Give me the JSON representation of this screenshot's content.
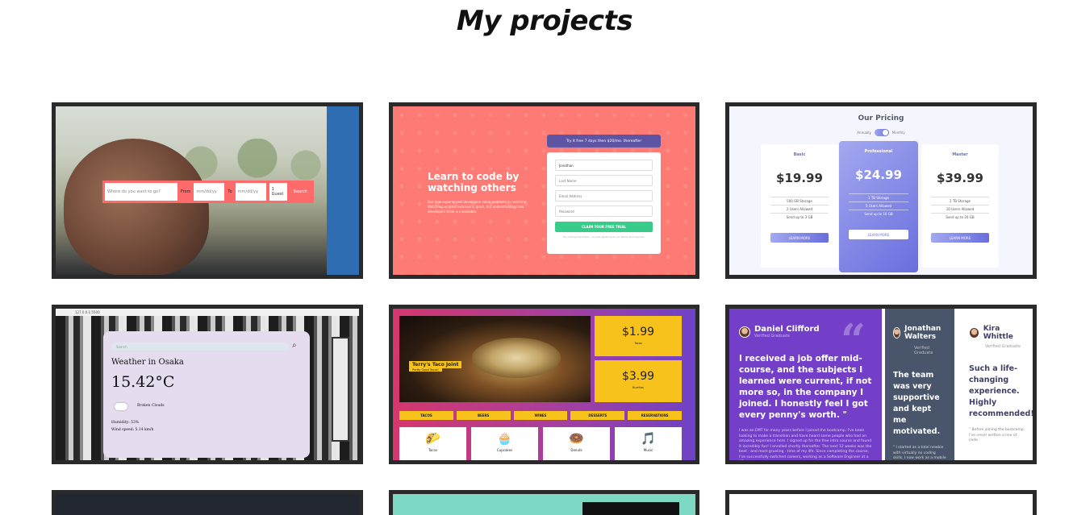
{
  "page": {
    "title": "My projects"
  },
  "projects": [
    {
      "name": "travel-search",
      "search_placeholder": "Where do you want to go?",
      "from_label": "From",
      "date_placeholder": "mm/dd/yy",
      "to_label": "To",
      "guests": "1 Guest",
      "search_button": "Search"
    },
    {
      "name": "learn-to-code",
      "heading": "Learn to code by watching others",
      "subtext": "See how experienced developers solve problems in real-time. Watching scripted tutorials is great, but understanding how developers think is invaluable.",
      "trial_banner": "Try it free 7 days then $20/mo. thereafter",
      "first_name_value": "Jonathan",
      "last_name_placeholder": "Last Name",
      "email_placeholder": "Email Address",
      "password_placeholder": "Password",
      "claim_button": "CLAIM YOUR FREE TRIAL",
      "terms": "By clicking the button, you are agreeing to our Terms and Services"
    },
    {
      "name": "pricing",
      "title": "Our Pricing",
      "toggle_left": "Annually",
      "toggle_right": "Monthly",
      "plans": [
        {
          "name": "Basic",
          "price": "$19.99",
          "features": [
            "500 GB Storage",
            "2 Users Allowed",
            "Send up to 3 GB"
          ],
          "button": "LEARN MORE"
        },
        {
          "name": "Professional",
          "price": "$24.99",
          "features": [
            "1 TB Storage",
            "5 Users Allowed",
            "Send up to 10 GB"
          ],
          "button": "LEARN MORE"
        },
        {
          "name": "Master",
          "price": "$39.99",
          "features": [
            "2 TB Storage",
            "10 Users Allowed",
            "Send up to 20 GB"
          ],
          "button": "LEARN MORE"
        }
      ]
    },
    {
      "name": "weather",
      "browser_url": "127.0.0.1:5500",
      "search_placeholder": "Search",
      "title": "Weather in Osaka",
      "temperature": "15.42°C",
      "condition": "Broken Clouds",
      "humidity": "Humidity: 53%",
      "wind": "Wind speed: 5.14 km/h"
    },
    {
      "name": "taco-joint",
      "brand": "Terry's Taco Joint",
      "tagline": "Pretty Good Tacos!",
      "prices": [
        {
          "amount": "$1.99",
          "label": "Tacos"
        },
        {
          "amount": "$3.99",
          "label": "Burritos"
        }
      ],
      "nav": [
        "TACOS",
        "BEERS",
        "WINES",
        "DESSERTS",
        "RESERVATIONS"
      ],
      "menu": [
        {
          "icon": "🌮",
          "label": "Tacos"
        },
        {
          "icon": "🧁",
          "label": "Cupcakes"
        },
        {
          "icon": "🍩",
          "label": "Donuts"
        },
        {
          "icon": "🎵",
          "label": "Music"
        }
      ]
    },
    {
      "name": "testimonials",
      "people": [
        {
          "name": "Daniel Clifford",
          "role": "Verified Graduate",
          "quote": "I received a job offer mid-course, and the subjects I learned were current, if not more so, in the company I joined. I honestly feel I got every penny's worth. \"",
          "detail": "I was an EMT for many years before I joined the bootcamp. I've been looking to make a transition and have heard some people who had an amazing experience here. I signed up for the free intro course and found it incredibly fun! I enrolled shortly thereafter. The next 12 weeks was the best - and most grueling - time of my life. Since completing the course, I've successfully switched careers, working as a Software Engineer at a VR startup."
        },
        {
          "name": "Jonathan Walters",
          "role": "Verified Graduate",
          "quote": "The team was very supportive and kept me motivated.",
          "detail": "\" I started as a total newbie with virtually no coding skills. I now work as a mobile engineer for a"
        },
        {
          "name": "Kira Whittle",
          "role": "Verified Graduate",
          "quote": "Such a life-changing experience. Highly recommended!",
          "detail": "\" Before joining the bootcamp, I've never written a line of code."
        }
      ]
    }
  ]
}
